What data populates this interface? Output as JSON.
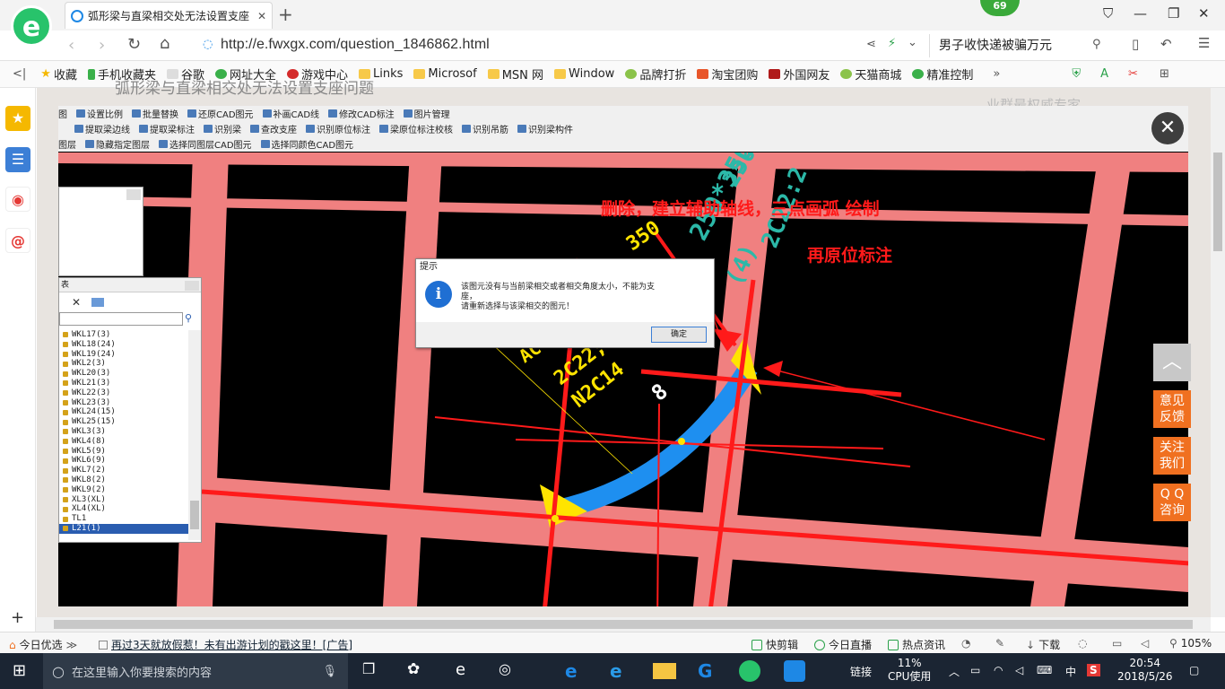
{
  "browser": {
    "tab_title": "弧形梁与直梁相交处无法设置支座",
    "url": "http://e.fwxgx.com/question_1846862.html",
    "search_text": "男子收快递被骗万元",
    "badge_count": "69",
    "accent": "#28c36b"
  },
  "bookmarks": [
    "收藏",
    "手机收藏夹",
    "谷歌",
    "网址大全",
    "游戏中心",
    "Links",
    "Microsof",
    "MSN 网",
    "Window",
    "品牌打折",
    "淘宝团购",
    "外国网友",
    "天猫商城",
    "精准控制"
  ],
  "page": {
    "headline": "弧形梁与直梁相交处无法设置支座问题",
    "right_text": "业群最权威专家"
  },
  "cad": {
    "toolbar1": [
      "图",
      "设置比例",
      "批量替换",
      "还原CAD图元",
      "补画CAD线",
      "修改CAD标注",
      "图片管理"
    ],
    "toolbar2": [
      "提取梁边线",
      "提取梁标注",
      "识别梁",
      "查改支座",
      "识别原位标注",
      "梁原位标注校核",
      "识别吊筋",
      "识别梁构件"
    ],
    "toolbar3": [
      "图层",
      "隐藏指定图层",
      "选择同图层CAD图元",
      "选择同颜色CAD图元"
    ],
    "panel_title": "表",
    "list_items": [
      "WKL17(3)",
      "WKL18(24)",
      "WKL19(24)",
      "WKL2(3)",
      "WKL20(3)",
      "WKL21(3)",
      "WKL22(3)",
      "WKL23(3)",
      "WKL24(15)",
      "WKL25(15)",
      "WKL3(3)",
      "WKL4(8)",
      "WKL5(9)",
      "WKL6(9)",
      "WKL7(2)",
      "WKL8(2)",
      "WKL9(2)",
      "XL3(XL)",
      "XL4(XL)",
      "TL1",
      "L21(1)"
    ],
    "selected_item": "L21(1)",
    "cad_texts": [
      "350",
      "2C22;",
      "(4)",
      "2C22:2",
      "250*350",
      "N2C14",
      "8",
      "AC",
      "250"
    ]
  },
  "dialog": {
    "title": "提示",
    "line1": "该图元没有与当前梁相交或者相交角度太小，不能为支",
    "line2": "座，",
    "line3": "请重新选择与该梁相交的图元！",
    "ok": "确定"
  },
  "annotations": {
    "line1": "删除，建立辅助轴线，三点画弧 绘制",
    "line2": "再原位标注"
  },
  "float_buttons": {
    "feedback": [
      "意见",
      "反馈"
    ],
    "follow": [
      "关注",
      "我们"
    ],
    "qq": [
      "Q Q",
      "咨询"
    ]
  },
  "status": {
    "left1": "今日优选",
    "ad": "再过3天就放假惹！未有出游计划的戳这里！[广告]",
    "kuaijianji": "快剪辑",
    "zhibo": "今日直播",
    "hot": "热点资讯",
    "download": "下载",
    "zoom": "105%"
  },
  "taskbar": {
    "search_placeholder": "在这里输入你要搜索的内容",
    "link": "链接",
    "cpu": "11%",
    "cpu_label": "CPU使用",
    "ime": "中",
    "time": "20:54",
    "date": "2018/5/26"
  },
  "colors": {
    "beam": "#f08080",
    "arc_beam": "#1e8ff0",
    "annotation": "#ff1a1a",
    "cad_text": "#2cb8a8"
  }
}
